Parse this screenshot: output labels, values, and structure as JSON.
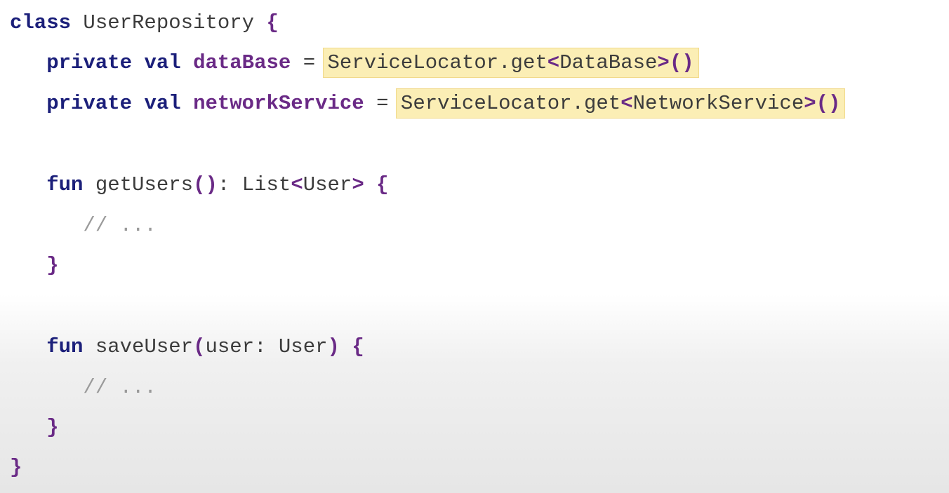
{
  "code": {
    "line1": {
      "keyword": "class",
      "name": " UserRepository ",
      "brace": "{"
    },
    "line2": {
      "indent": "   ",
      "modifiers": "private val",
      "space": " ",
      "property": "dataBase",
      "equals": " = ",
      "call_prefix": "ServiceLocator.get",
      "type_open": "<",
      "type": "DataBase",
      "type_close": ">",
      "parens": "()"
    },
    "line3": {
      "indent": "   ",
      "modifiers": "private val",
      "space": " ",
      "property": "networkService",
      "equals": " = ",
      "call_prefix": "ServiceLocator.get",
      "type_open": "<",
      "type": "NetworkService",
      "type_close": ">",
      "parens": "()"
    },
    "line5": {
      "indent": "   ",
      "keyword": "fun",
      "name": " getUsers",
      "parens": "()",
      "return": ": List",
      "type_open": "<",
      "type": "User",
      "type_close": ">",
      "space": " ",
      "brace": "{"
    },
    "line6": {
      "indent": "      ",
      "comment": "// ..."
    },
    "line7": {
      "indent": "   ",
      "brace": "}"
    },
    "line9": {
      "indent": "   ",
      "keyword": "fun",
      "name": " saveUser",
      "paren_open": "(",
      "params": "user: User",
      "paren_close": ")",
      "space": " ",
      "brace": "{"
    },
    "line10": {
      "indent": "      ",
      "comment": "// ..."
    },
    "line11": {
      "indent": "   ",
      "brace": "}"
    },
    "line12": {
      "brace": "}"
    }
  },
  "colors": {
    "keyword": "#1b1f7a",
    "property": "#6a2a86",
    "highlight": "#fbeeb5",
    "comment": "#9a9a9a",
    "text": "#3c3c3c"
  }
}
